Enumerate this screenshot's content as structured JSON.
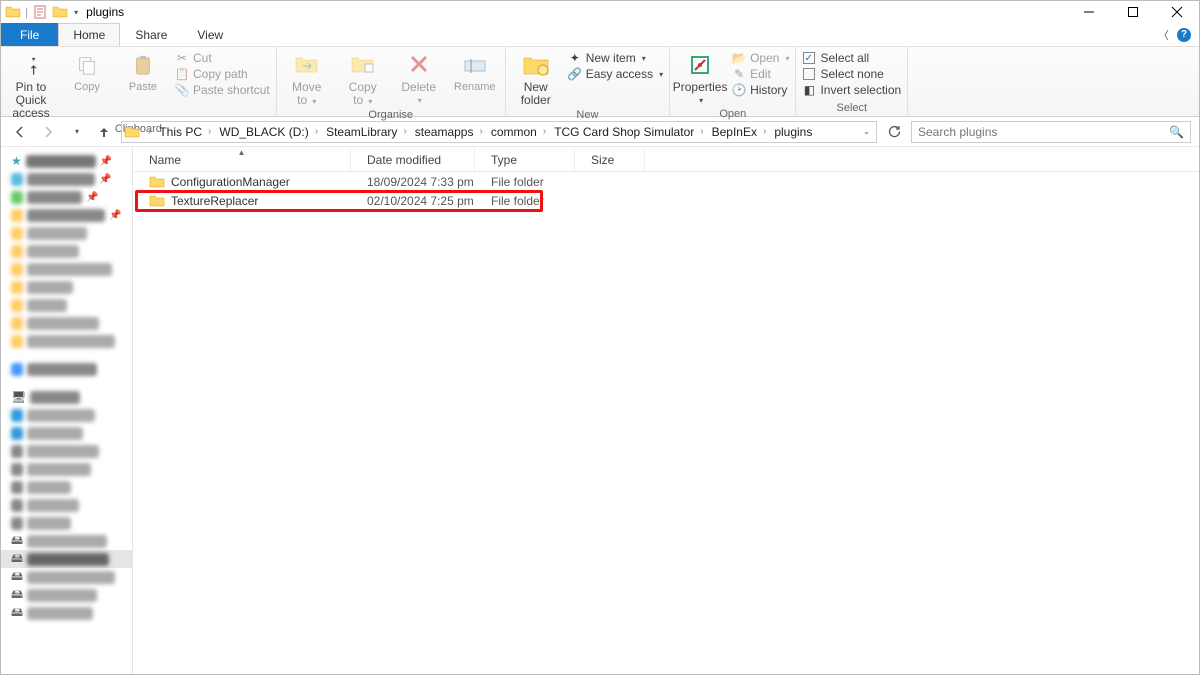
{
  "window": {
    "title": "plugins"
  },
  "tabs": {
    "file": "File",
    "home": "Home",
    "share": "Share",
    "view": "View"
  },
  "ribbon": {
    "clipboard": {
      "label": "Clipboard",
      "pin1": "Pin to Quick",
      "pin2": "access",
      "copy": "Copy",
      "paste": "Paste",
      "cut": "Cut",
      "copypath": "Copy path",
      "pasteshortcut": "Paste shortcut"
    },
    "organise": {
      "label": "Organise",
      "move1": "Move",
      "move2": "to",
      "copy1": "Copy",
      "copy2": "to",
      "delete": "Delete",
      "rename": "Rename"
    },
    "new": {
      "label": "New",
      "newfolder1": "New",
      "newfolder2": "folder",
      "newitem": "New item",
      "easyaccess": "Easy access"
    },
    "open": {
      "label": "Open",
      "properties": "Properties",
      "open": "Open",
      "edit": "Edit",
      "history": "History"
    },
    "select": {
      "label": "Select",
      "all": "Select all",
      "none": "Select none",
      "invert": "Invert selection"
    }
  },
  "breadcrumbs": [
    "This PC",
    "WD_BLACK (D:)",
    "SteamLibrary",
    "steamapps",
    "common",
    "TCG Card Shop Simulator",
    "BepInEx",
    "plugins"
  ],
  "search": {
    "placeholder": "Search plugins"
  },
  "columns": {
    "name": "Name",
    "date": "Date modified",
    "type": "Type",
    "size": "Size"
  },
  "rows": [
    {
      "name": "ConfigurationManager",
      "date": "18/09/2024 7:33 pm",
      "type": "File folder",
      "size": ""
    },
    {
      "name": "TextureReplacer",
      "date": "02/10/2024 7:25 pm",
      "type": "File folder",
      "size": ""
    }
  ]
}
